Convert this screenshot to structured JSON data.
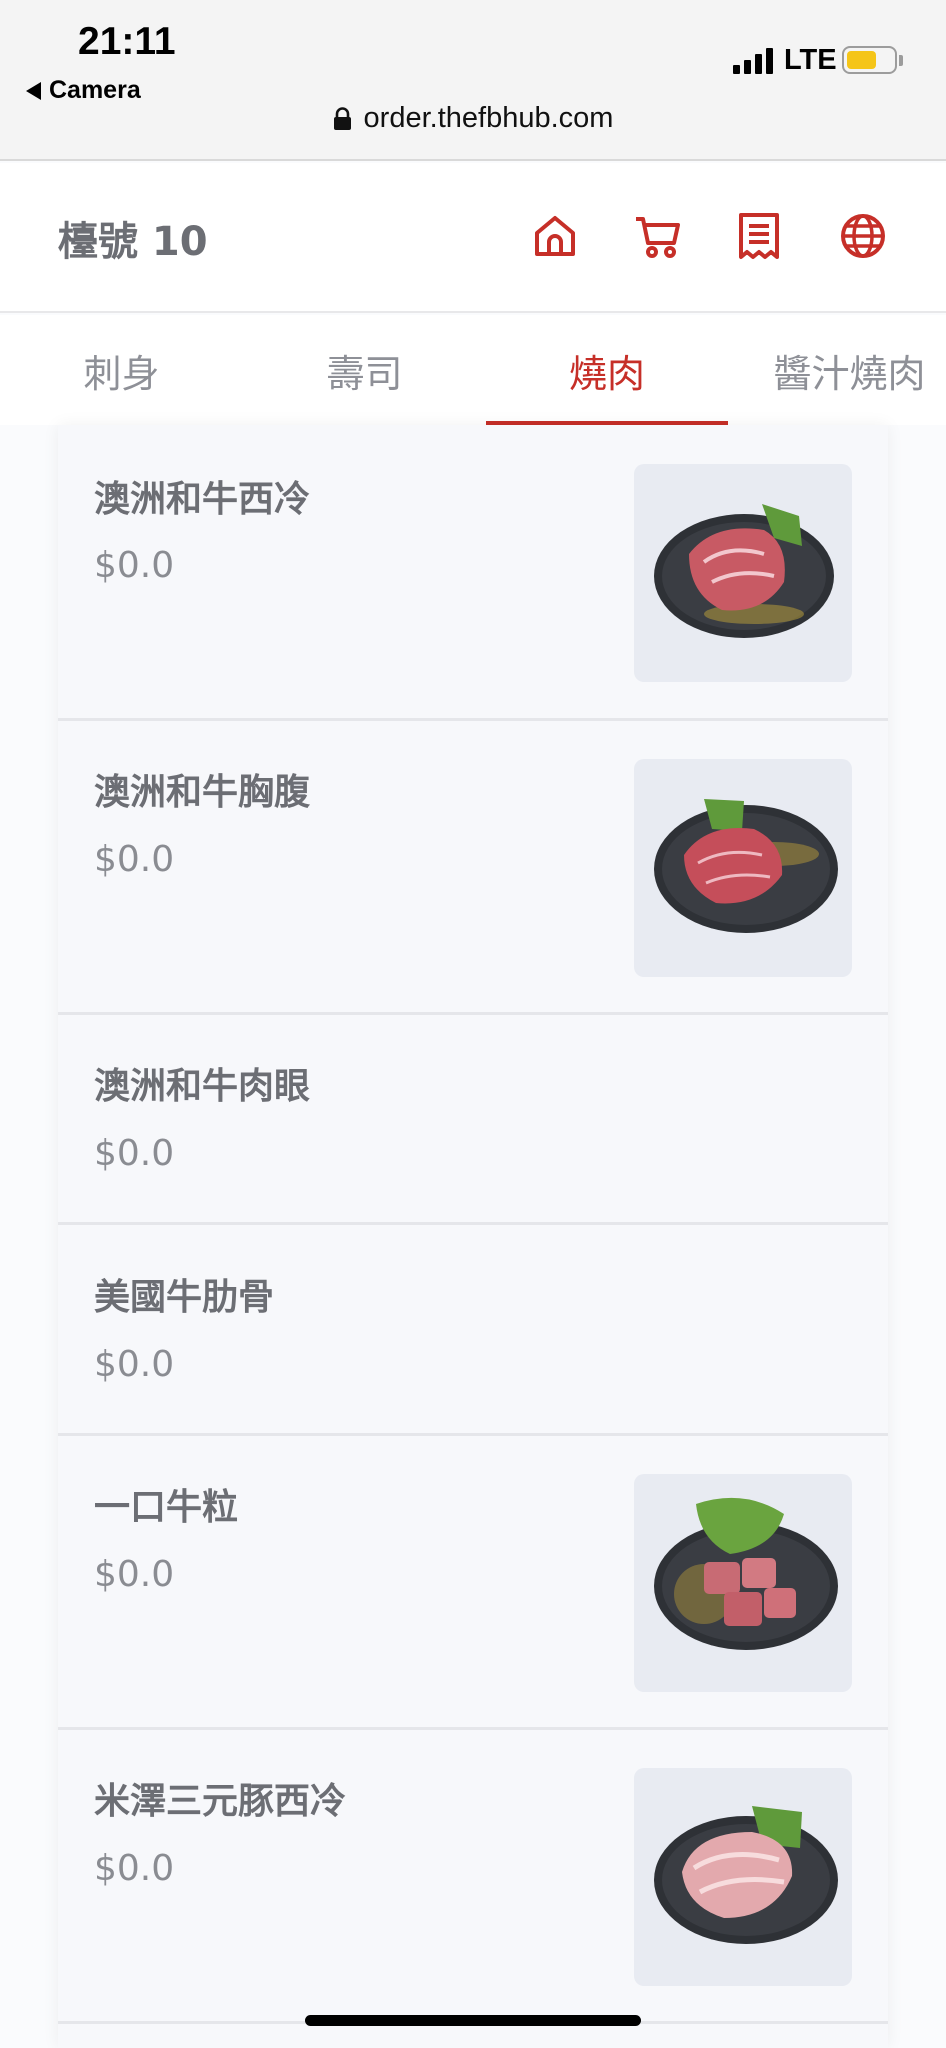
{
  "status_bar": {
    "time": "21:11",
    "back_label": "Camera",
    "network": "LTE",
    "battery_color": "#f5c518"
  },
  "browser": {
    "url": "order.thefbhub.com"
  },
  "header": {
    "table_label": "檯號 10",
    "icons": [
      "home-icon",
      "cart-icon",
      "receipt-icon",
      "globe-icon"
    ],
    "accent_color": "#c62f28"
  },
  "tabs": [
    {
      "label": "刺身",
      "active": false
    },
    {
      "label": "壽司",
      "active": false
    },
    {
      "label": "燒肉",
      "active": true
    },
    {
      "label": "醬汁燒肉",
      "active": false
    }
  ],
  "items": [
    {
      "name": "澳洲和牛西冷",
      "price": "$0.0",
      "has_photo": true
    },
    {
      "name": "澳洲和牛胸腹",
      "price": "$0.0",
      "has_photo": true
    },
    {
      "name": "澳洲和牛肉眼",
      "price": "$0.0",
      "has_photo": false
    },
    {
      "name": "美國牛肋骨",
      "price": "$0.0",
      "has_photo": false
    },
    {
      "name": "一口牛粒",
      "price": "$0.0",
      "has_photo": true
    },
    {
      "name": "米澤三元豚西冷",
      "price": "$0.0",
      "has_photo": true
    }
  ]
}
